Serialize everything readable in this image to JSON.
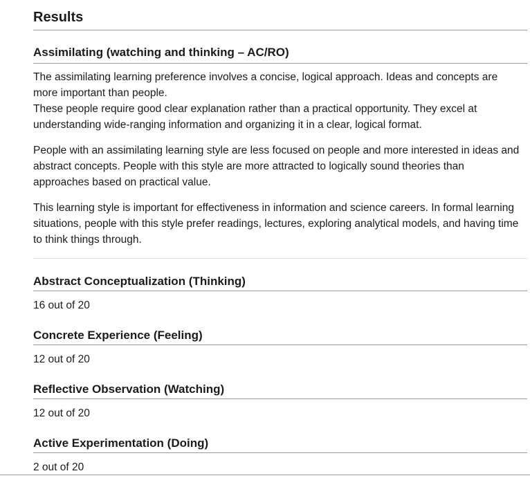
{
  "results": {
    "title": "Results",
    "style": {
      "heading": "Assimilating (watching and thinking – AC/RO)",
      "paragraphs": [
        "The assimilating learning preference involves a concise, logical approach. Ideas and concepts are more important than people.",
        "These people require good clear explanation rather than a practical opportunity. They excel at understanding wide-ranging information and organizing it in a clear, logical format.",
        "People with an assimilating learning style are less focused on people and more interested in ideas and abstract concepts. People with this style are more attracted to logically sound theories than approaches based on practical value.",
        "This learning style is important for effectiveness in information and science careers. In formal learning situations, people with this style prefer readings, lectures, exploring analytical models, and having time to think things through."
      ]
    },
    "scores": [
      {
        "label": "Abstract Conceptualization (Thinking)",
        "value": "16 out of 20"
      },
      {
        "label": "Concrete Experience (Feeling)",
        "value": "12 out of 20"
      },
      {
        "label": "Reflective Observation (Watching)",
        "value": "12 out of 20"
      },
      {
        "label": "Active Experimentation (Doing)",
        "value": "2 out of 20"
      }
    ]
  }
}
